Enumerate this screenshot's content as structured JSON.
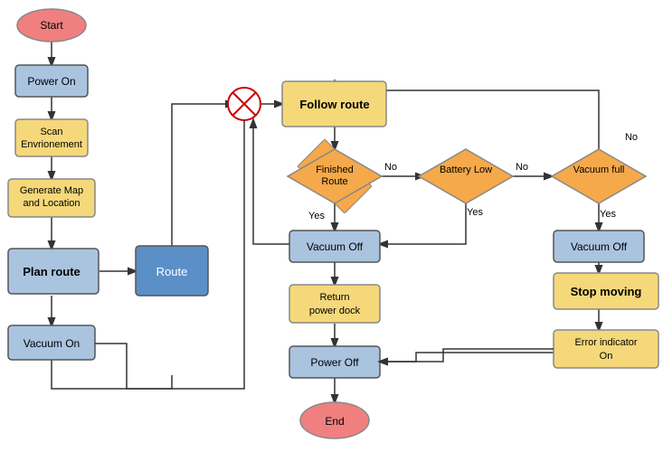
{
  "nodes": {
    "start": {
      "label": "Start"
    },
    "power_on": {
      "label": "Power On"
    },
    "scan_env": {
      "label": "Scan Envrionement"
    },
    "gen_map": {
      "label": "Generate Map and Location"
    },
    "plan_route": {
      "label": "Plan route"
    },
    "route": {
      "label": "Route"
    },
    "vacuum_on": {
      "label": "Vacuum On"
    },
    "follow_route": {
      "label": "Follow route"
    },
    "finished_route": {
      "label": "Finished Route"
    },
    "battery_low": {
      "label": "Battery Low"
    },
    "vacuum_full": {
      "label": "Vacuum full"
    },
    "vacuum_off_left": {
      "label": "Vacuum Off"
    },
    "return_power_dock": {
      "label": "Return power dock"
    },
    "vacuum_off_right": {
      "label": "Vacuum Off"
    },
    "stop_moving": {
      "label": "Stop moving"
    },
    "power_off": {
      "label": "Power Off"
    },
    "error_indicator": {
      "label": "Error indicator On"
    },
    "end": {
      "label": "End"
    },
    "yes": {
      "label": "Yes"
    },
    "no": {
      "label": "No"
    }
  },
  "colors": {
    "oval_fill": "#f08080",
    "rect_blue": "#aac4e0",
    "rect_yellow": "#f5d87a",
    "diamond": "#f5a94a",
    "line": "#333"
  }
}
